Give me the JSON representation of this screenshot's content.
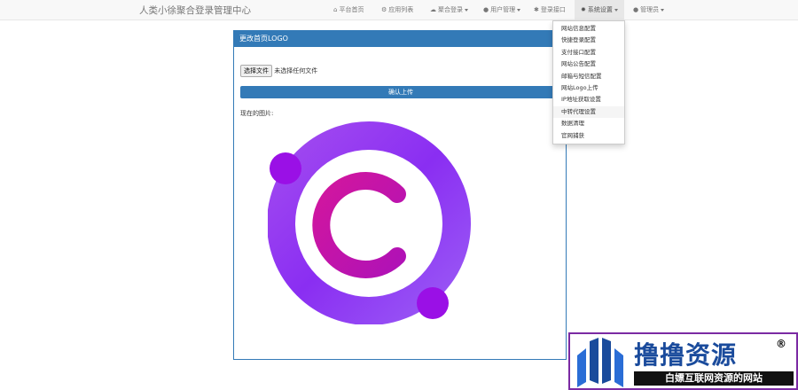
{
  "navbar": {
    "brand": "人类小徐聚合登录管理中心",
    "items": [
      {
        "label": "平台首页",
        "icon": "home-icon",
        "caret": false
      },
      {
        "label": "应用列表",
        "icon": "apps-icon",
        "caret": false
      },
      {
        "label": "聚合登录",
        "icon": "cloud-icon",
        "caret": true
      },
      {
        "label": "用户管理",
        "icon": "user-icon",
        "caret": true
      },
      {
        "label": "登录接口",
        "icon": "plugin-icon",
        "caret": false
      },
      {
        "label": "系统设置",
        "icon": "gear-icon",
        "caret": true
      },
      {
        "label": "管理员",
        "icon": "admin-user-icon",
        "caret": true
      }
    ]
  },
  "dropdown": {
    "items": [
      "网站信息配置",
      "快捷登录配置",
      "支付接口配置",
      "网站公告配置",
      "邮箱与短信配置",
      "网站Logo上传",
      "IP地址获取设置",
      "中转代理设置",
      "数据清理",
      "官网捕获"
    ],
    "hovered_index": 7
  },
  "panel": {
    "title": "更改首页LOGO",
    "file_button": "选择文件",
    "file_status": "未选择任何文件",
    "upload_button": "确认上传",
    "current_label": "现在的图片:"
  },
  "watermark": {
    "title": "撸撸资源",
    "registered": "®",
    "subtitle": "白嫖互联网资源的网站"
  },
  "colors": {
    "primary": "#337ab7",
    "logo_purple": "#8b3cf0",
    "logo_magenta": "#e0128f"
  }
}
